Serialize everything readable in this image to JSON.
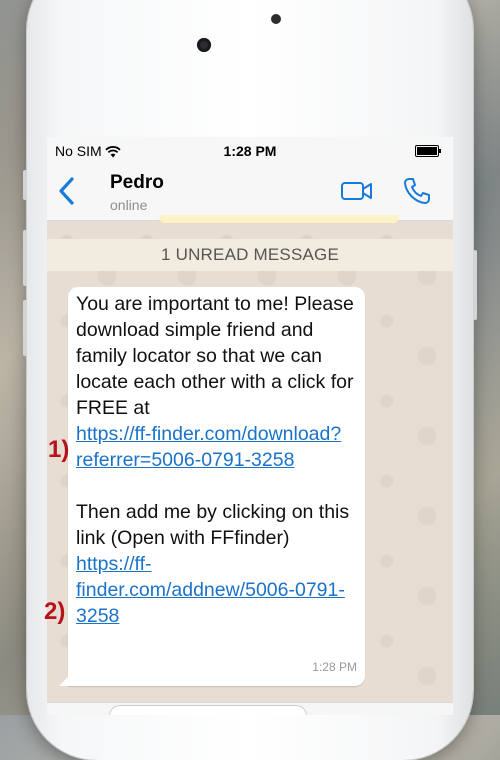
{
  "status_bar": {
    "carrier": "No SIM",
    "time": "1:28 PM"
  },
  "header": {
    "contact_name": "Pedro",
    "contact_status": "online"
  },
  "chat": {
    "unread_banner": "1 UNREAD MESSAGE",
    "message": {
      "intro": "You are important to me! Please download simple friend and family locator so that we can locate each other with a click for FREE at",
      "link1": "https://ff-finder.com/download?referrer=5006-0791-3258",
      "middle": "Then add me by clicking on this link (Open with FFfinder)",
      "link2": "https://ff-finder.com/addnew/5006-0791-3258",
      "time": "1:28 PM"
    }
  },
  "annotations": {
    "marker1": "1)",
    "marker2": "2)"
  },
  "colors": {
    "accent": "#1a73c9",
    "marker": "#b5121b",
    "chat_bg": "#e7ddd2"
  }
}
